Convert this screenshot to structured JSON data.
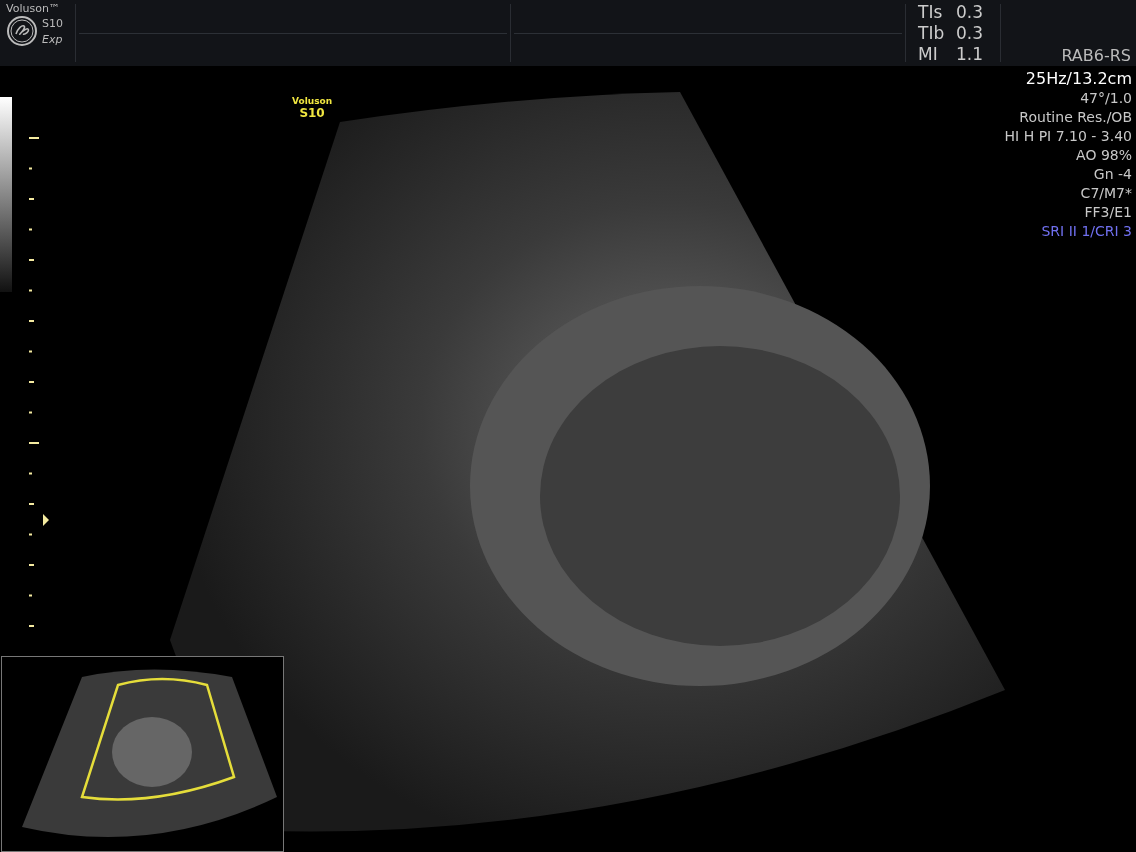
{
  "header": {
    "brand": "Voluson™",
    "model": "S10",
    "edition": "Exp"
  },
  "safety_indices": [
    {
      "label": "TIs",
      "value": "0.3"
    },
    {
      "label": "TIb",
      "value": "0.3"
    },
    {
      "label": "MI",
      "value": "1.1"
    }
  ],
  "probe": "RAB6-RS",
  "image_label": {
    "brand": "Voluson",
    "model": "S10"
  },
  "parameters": [
    {
      "text": "25Hz/13.2cm",
      "kind": "primary"
    },
    {
      "text": "47°/1.0",
      "kind": "normal"
    },
    {
      "text": "Routine Res./OB",
      "kind": "normal"
    },
    {
      "text": "HI H PI 7.10 - 3.40",
      "kind": "normal"
    },
    {
      "text": "AO 98%",
      "kind": "normal"
    },
    {
      "text": "Gn  -4",
      "kind": "normal"
    },
    {
      "text": "C7/M7*",
      "kind": "normal"
    },
    {
      "text": "FF3/E1",
      "kind": "normal"
    },
    {
      "text": "SRI II 1/CRI 3",
      "kind": "highlight"
    }
  ]
}
